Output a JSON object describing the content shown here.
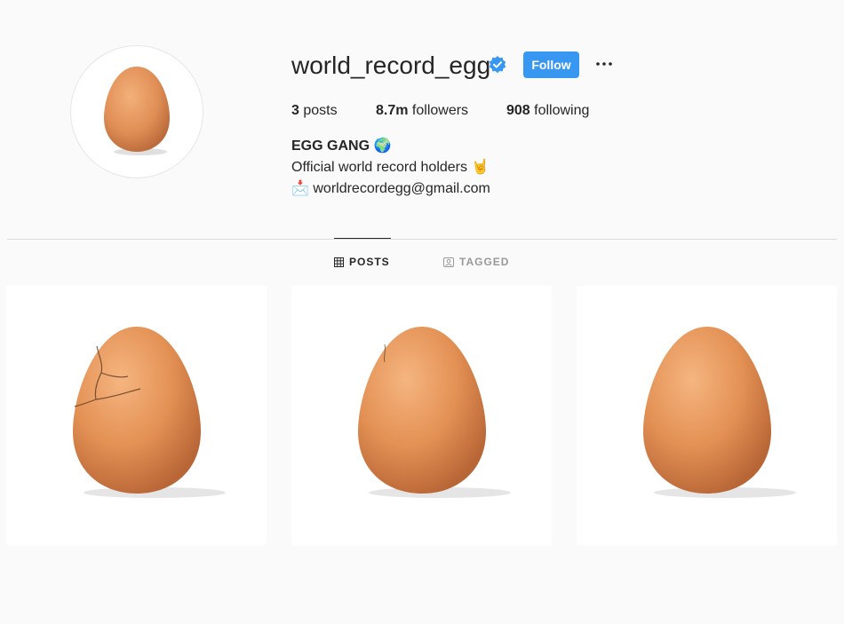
{
  "profile": {
    "username": "world_record_egg",
    "follow_label": "Follow",
    "more_label": "···",
    "stats": [
      {
        "count": "3",
        "label": " posts"
      },
      {
        "count": "8.7m",
        "label": " followers"
      },
      {
        "count": "908",
        "label": " following"
      }
    ],
    "bio": {
      "name": "EGG GANG 🌍",
      "line1": "Official world record holders 🤘",
      "line2": "📩 worldrecordegg@gmail.com"
    }
  },
  "tabs": [
    {
      "label": "POSTS",
      "icon": "grid-icon",
      "active": true
    },
    {
      "label": "TAGGED",
      "icon": "tagged-icon",
      "active": false
    }
  ],
  "posts": [
    {
      "icon": "cracked-egg-image",
      "crack": "heavy"
    },
    {
      "icon": "slightly-cracked-egg-image",
      "crack": "light"
    },
    {
      "icon": "egg-image",
      "crack": "none"
    }
  ],
  "colors": {
    "accent": "#3897f0",
    "egg": "#e0935a",
    "background": "#fafafa"
  }
}
